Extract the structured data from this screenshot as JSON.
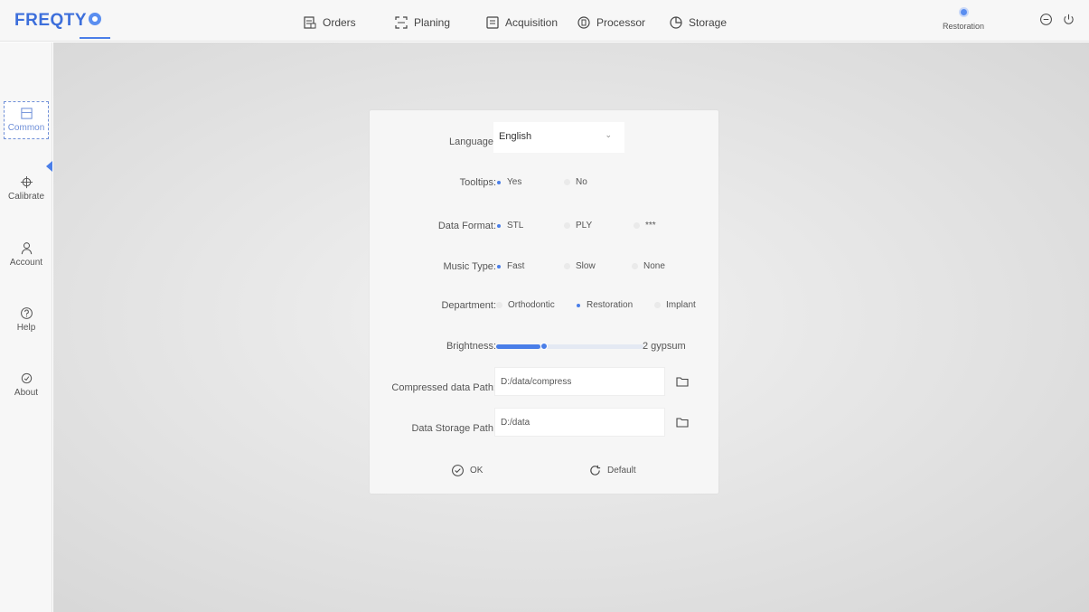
{
  "app": {
    "brand": "FREQTY",
    "nav": [
      {
        "label": "Orders",
        "icon": "orders-icon"
      },
      {
        "label": "Planing",
        "icon": "planing-icon"
      },
      {
        "label": "Acquisition",
        "icon": "acquisition-icon"
      },
      {
        "label": "Processor",
        "icon": "processor-icon"
      },
      {
        "label": "Storage",
        "icon": "storage-icon"
      }
    ],
    "department_badge": "Restoration"
  },
  "sidebar": {
    "items": [
      {
        "label": "Common",
        "icon": "common-icon",
        "active": true
      },
      {
        "label": "Calibrate",
        "icon": "crosshair-icon"
      },
      {
        "label": "Account",
        "icon": "user-icon"
      },
      {
        "label": "Help",
        "icon": "help-icon"
      },
      {
        "label": "About",
        "icon": "about-icon"
      }
    ]
  },
  "settings": {
    "language": {
      "label": "Language:",
      "value": "English"
    },
    "tooltips": {
      "label": "Tooltips:",
      "options": [
        "Yes",
        "No"
      ],
      "selected": "Yes"
    },
    "data_format": {
      "label": "Data Format:",
      "options": [
        "STL",
        "PLY",
        "***"
      ],
      "selected": "STL"
    },
    "music_type": {
      "label": "Music Type:",
      "options": [
        "Fast",
        "Slow",
        "None"
      ],
      "selected": "Fast"
    },
    "department": {
      "label": "Department:",
      "options": [
        "Orthodontic",
        "Restoration",
        "Implant"
      ],
      "selected": "Restoration"
    },
    "brightness": {
      "label": "Brightness:",
      "value_text": "2 gypsum",
      "level_fraction": 0.3
    },
    "compressed_path": {
      "label": "Compressed data Path:",
      "value": "D:/data/compress"
    },
    "storage_path": {
      "label": "Data Storage Path:",
      "value": "D:/data"
    },
    "ok_label": "OK",
    "default_label": "Default"
  },
  "colors": {
    "accent": "#4a7ee8",
    "brand": "#3d6fdb"
  }
}
